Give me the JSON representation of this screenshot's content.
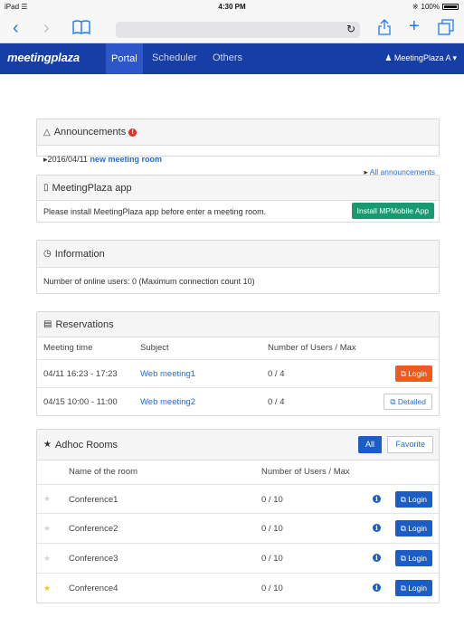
{
  "status_bar": {
    "device": "iPad",
    "time": "4:30 PM",
    "battery": "100%"
  },
  "browser": {
    "back_icon": "chevron-left-icon",
    "forward_icon": "chevron-right-icon",
    "bookmarks_icon": "book-icon",
    "reload_icon": "reload-icon",
    "share_icon": "share-icon",
    "new_tab_icon": "plus-icon",
    "tabs_icon": "tabs-icon"
  },
  "nav": {
    "brand": "meetingplaza",
    "links": [
      "Portal",
      "Scheduler",
      "Others"
    ],
    "active": "Portal",
    "user": "MeetingPlaza A"
  },
  "announcements": {
    "title": "Announcements",
    "items": [
      {
        "date": "2016/04/11",
        "text": "new meeting room"
      }
    ],
    "all_link": "All announcements"
  },
  "app": {
    "title": "MeetingPlaza app",
    "message": "Please install MeetingPlaza app before enter a meeting room.",
    "button": "Install MPMobile App"
  },
  "information": {
    "title": "Information",
    "text": "Number of online users: 0 (Maximum connection count 10)"
  },
  "reservations": {
    "title": "Reservations",
    "columns": [
      "Meeting time",
      "Subject",
      "Number of Users / Max"
    ],
    "rows": [
      {
        "time": "04/11 16:23 - 17:23",
        "subject": "Web meeting1",
        "users": "0 / 4",
        "action": "Login"
      },
      {
        "time": "04/15 10:00 - 11:00",
        "subject": "Web meeting2",
        "users": "0 / 4",
        "action": "Detailed"
      }
    ]
  },
  "adhoc": {
    "title": "Adhoc Rooms",
    "filter_all": "All",
    "filter_favorite": "Favorite",
    "columns": [
      "Name of the room",
      "Number of Users / Max"
    ],
    "rooms": [
      {
        "name": "Conference1",
        "users": "0 / 10",
        "favorite": false,
        "action": "Login"
      },
      {
        "name": "Conference2",
        "users": "0 / 10",
        "favorite": false,
        "action": "Login"
      },
      {
        "name": "Conference3",
        "users": "0 / 10",
        "favorite": false,
        "action": "Login"
      },
      {
        "name": "Conference4",
        "users": "0 / 10",
        "favorite": true,
        "action": "Login"
      }
    ]
  },
  "colors": {
    "navbar": "#173ea5",
    "primary": "#1a5dc7",
    "success": "#18996f",
    "danger": "#ee5a1f",
    "favorite_star": "#f5c518"
  }
}
